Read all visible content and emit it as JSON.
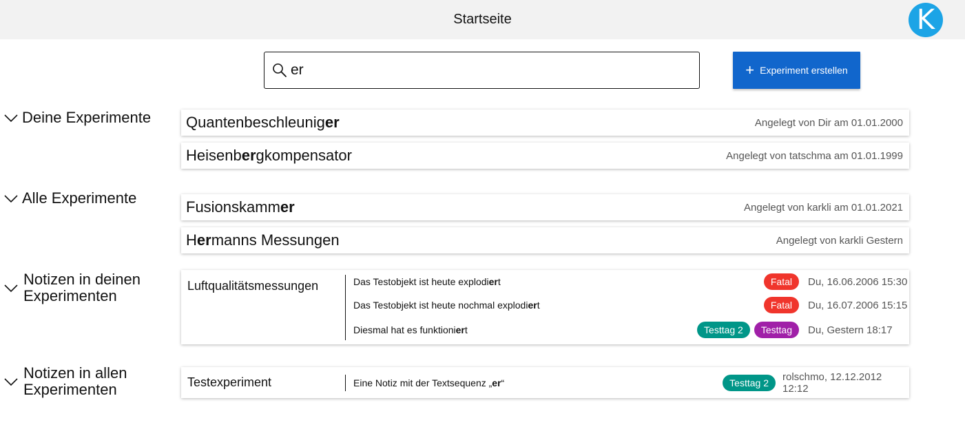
{
  "header": {
    "title": "Startseite",
    "avatar_letter": "K"
  },
  "search": {
    "value": "er",
    "placeholder": ""
  },
  "create_button": {
    "label": "Experiment erstellen"
  },
  "sections": {
    "my_experiments": "Deine Experimente",
    "all_experiments": "Alle Experimente",
    "notes_my": "Notizen in deinen Experimenten",
    "notes_all": "Notizen in allen Experimenten"
  },
  "my_experiments": [
    {
      "name_before": "Quantenbeschleunig",
      "name_match": "er",
      "name_after": "",
      "meta": "Angelegt von Dir am 01.01.2000"
    },
    {
      "name_before": "Heisenb",
      "name_match": "er",
      "name_after": "gkompensator",
      "meta": "Angelegt von tatschma am 01.01.1999"
    }
  ],
  "all_experiments": [
    {
      "name_before": "Fusionskamm",
      "name_match": "er",
      "name_after": "",
      "meta": "Angelegt von karkli am 01.01.2021"
    },
    {
      "name_before": "H",
      "name_match": "er",
      "name_after": "manns Messungen",
      "meta": "Angelegt von karkli Gestern"
    }
  ],
  "notes_my": {
    "experiment": "Luftqualitätsmessungen",
    "notes": [
      {
        "before": "Das Testobjekt ist heute explodi",
        "match": "er",
        "after": "t",
        "tag": "Fatal",
        "date": "Du, 16.06.2006 15:30"
      },
      {
        "before": "Das Testobjekt ist heute nochmal explodi",
        "match": "er",
        "after": "t",
        "tag": "Fatal",
        "date": "Du, 16.07.2006 15:15"
      },
      {
        "before": "Diesmal hat es funktioni",
        "match": "er",
        "after": "t",
        "tag1": "Testtag 2",
        "tag2": "Testtag",
        "date": "Du, Gestern 18:17"
      }
    ]
  },
  "notes_all": {
    "experiment": "Testexperiment",
    "notes": [
      {
        "before": "Eine Notiz mit der Textsequenz „",
        "match": "er",
        "after": "“",
        "tag": "Testtag 2",
        "date": "rolschmo, 12.12.2012 12:12"
      }
    ]
  },
  "colors": {
    "accent": "#1166cc",
    "avatar": "#1ca4e6",
    "fatal": "#f0352c",
    "teal": "#009688",
    "purple": "#a020a8"
  },
  "icons": {
    "search": "search-icon",
    "chevron": "chevron-down-icon",
    "plus": "plus-icon"
  }
}
